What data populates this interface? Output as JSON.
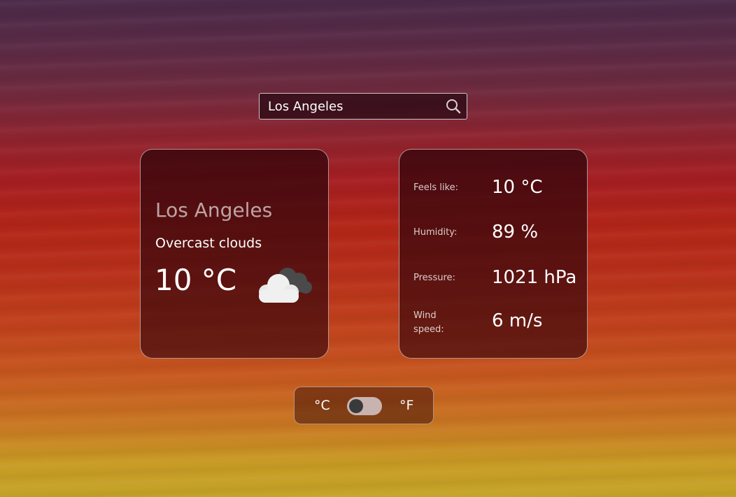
{
  "search": {
    "value": "Los Angeles",
    "icon": "search-icon"
  },
  "current": {
    "city": "Los Angeles",
    "condition": "Overcast clouds",
    "temperature": "10 °C",
    "icon": "overcast-clouds-icon"
  },
  "details": {
    "feels_like": {
      "label": "Feels like:",
      "value": "10 °C"
    },
    "humidity": {
      "label": "Humidity:",
      "value": "89 %"
    },
    "pressure": {
      "label": "Pressure:",
      "value": "1021 hPa"
    },
    "wind_speed": {
      "label": "Wind speed:",
      "value": "6 m/s"
    }
  },
  "units": {
    "celsius_label": "°C",
    "fahrenheit_label": "°F",
    "selected": "°C"
  },
  "colors": {
    "card_bg": "#3a0a10",
    "toggle_track": "#c9b3b0",
    "toggle_knob": "#3a3a3a"
  }
}
